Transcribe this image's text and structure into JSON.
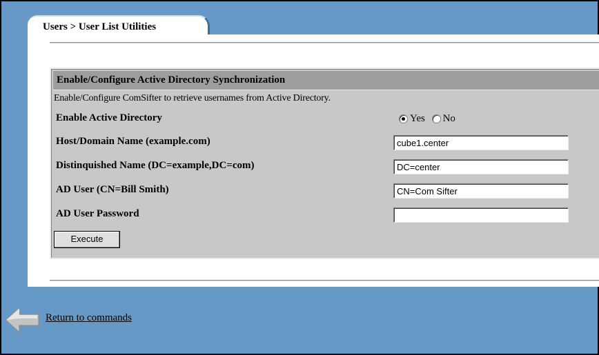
{
  "tab": {
    "label": "Users > User List Utilities"
  },
  "section": {
    "title": "Enable/Configure Active Directory Synchronization",
    "description": "Enable/Configure ComSifter to retrieve usernames from Active Directory."
  },
  "fields": {
    "enable_ad": {
      "label": "Enable Active Directory",
      "options": [
        "Yes",
        "No"
      ],
      "selected": "Yes"
    },
    "host": {
      "label": "Host/Domain Name (example.com)",
      "value": "cube1.center"
    },
    "dn": {
      "label": "Distinquished Name (DC=example,DC=com)",
      "value": "DC=center"
    },
    "ad_user": {
      "label": "AD User (CN=Bill Smith)",
      "value": "CN=Com Sifter"
    },
    "ad_password": {
      "label": "AD User Password",
      "value": ""
    }
  },
  "execute_label": "Execute",
  "return_link": "Return to commands",
  "icons": {
    "tab": "tab-icon",
    "return": "left-arrow-icon"
  }
}
